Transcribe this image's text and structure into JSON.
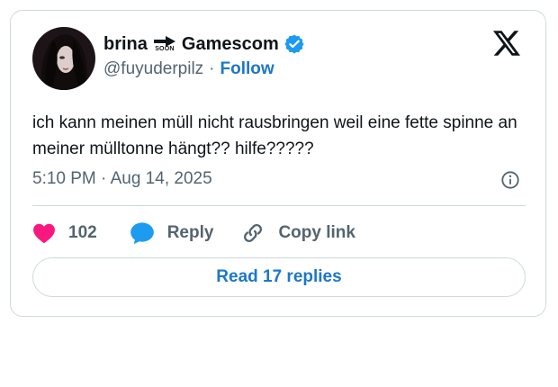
{
  "author": {
    "name_part1": "brina",
    "arrow_label": "SOON",
    "name_part2": "Gamescom",
    "handle": "@fuyuderpilz",
    "separator": "·",
    "follow_label": "Follow"
  },
  "tweet": {
    "text": "ich kann meinen müll nicht rausbringen weil eine fette spinne an meiner mülltonne hängt?? hilfe?????",
    "timestamp": "5:10 PM · Aug 14, 2025"
  },
  "actions": {
    "like_count": "102",
    "reply_label": "Reply",
    "copy_link_label": "Copy link"
  },
  "read_replies_label": "Read 17 replies",
  "colors": {
    "accent": "#1d77c7",
    "heart": "#f91880",
    "reply_bubble": "#1d9bf0",
    "verified": "#1d9bf0",
    "muted_text": "#536471",
    "border": "#cfd9de"
  },
  "icons": [
    "avatar-image",
    "soon-arrow-icon",
    "verified-badge-icon",
    "x-logo-icon",
    "info-icon",
    "heart-icon",
    "reply-bubble-icon",
    "link-icon"
  ]
}
